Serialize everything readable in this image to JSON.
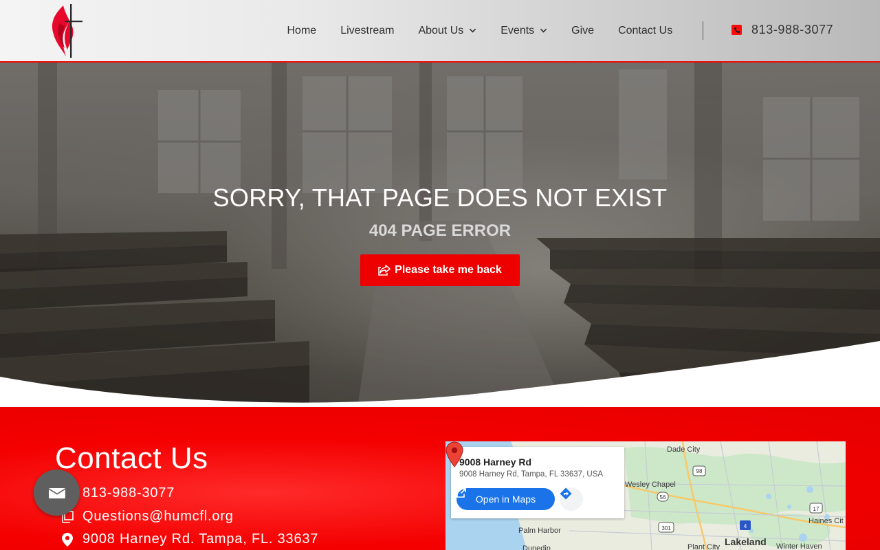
{
  "header": {
    "nav": [
      {
        "label": "Home",
        "has_dropdown": false
      },
      {
        "label": "Livestream",
        "has_dropdown": false
      },
      {
        "label": "About Us",
        "has_dropdown": true
      },
      {
        "label": "Events",
        "has_dropdown": true
      },
      {
        "label": "Give",
        "has_dropdown": false
      },
      {
        "label": "Contact Us",
        "has_dropdown": false
      }
    ],
    "phone": "813-988-3077",
    "phone_icon": "phone-icon",
    "logo_icon": "cross-flame-logo"
  },
  "hero": {
    "title": "SORRY, THAT PAGE DOES NOT EXIST",
    "subtitle": "404 PAGE ERROR",
    "button_label": "Please take me back",
    "button_icon": "external-share-icon"
  },
  "contact": {
    "title": "Contact Us",
    "phone": "813-988-3077",
    "email": "Questions@humcfl.org",
    "address": "9008 Harney Rd. Tampa, FL. 33637",
    "float_icon": "envelope-icon"
  },
  "map": {
    "card_title": "9008 Harney Rd",
    "card_address": "9008 Harney Rd, Tampa, FL 33637, USA",
    "open_label": "Open in Maps",
    "places": [
      "Dade City",
      "Wesley Chapel",
      "Palm Harbor",
      "Lakeland",
      "Haines Cit",
      "Winter Haven",
      "Plant City",
      "Dunedin"
    ],
    "routes": [
      "98",
      "56",
      "301",
      "17",
      "4"
    ]
  },
  "colors": {
    "accent": "#ee0000",
    "nav_text": "#2f2f2f",
    "map_button": "#1a73e8"
  }
}
